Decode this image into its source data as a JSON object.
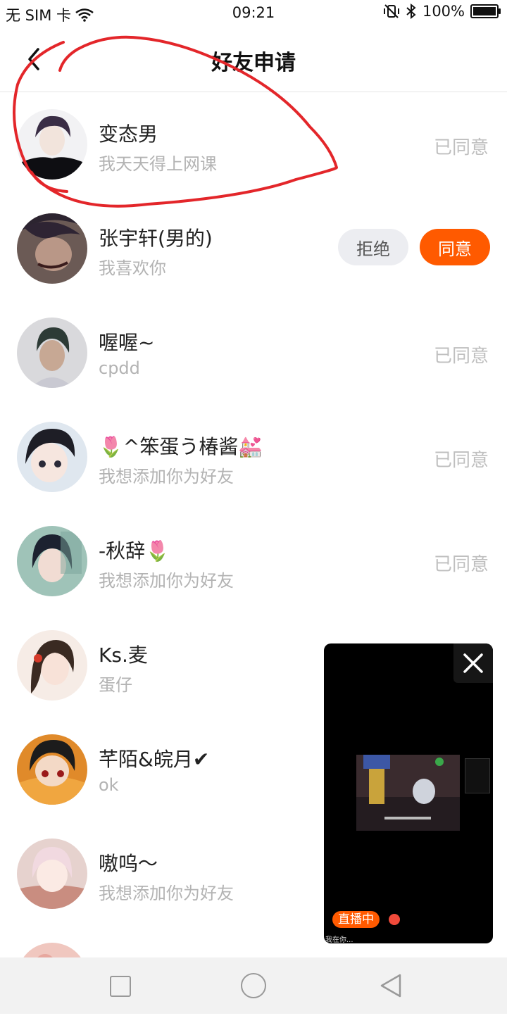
{
  "status": {
    "carrier": "无 SIM 卡",
    "time": "09:21",
    "battery": "100%"
  },
  "header": {
    "title": "好友申请"
  },
  "rows": [
    {
      "name": "变态男",
      "message": "我天天得上网课",
      "status": "已同意"
    },
    {
      "name": "张宇轩(男的)",
      "message": "我喜欢你",
      "reject_label": "拒绝",
      "accept_label": "同意"
    },
    {
      "name": "喔喔~",
      "message": "cpdd",
      "status": "已同意"
    },
    {
      "name": "🌷^笨蛋う椿酱💒",
      "message": "我想添加你为好友",
      "status": "已同意"
    },
    {
      "name": "-秋辞🌷",
      "message": "我想添加你为好友",
      "status": "已同意"
    },
    {
      "name": "Ks.麦",
      "message": "蛋仔"
    },
    {
      "name": "芊陌&皖月✔",
      "message": "ok"
    },
    {
      "name": "嗷呜～",
      "message": "我想添加你为好友"
    }
  ],
  "live_window": {
    "badge": "直播中",
    "caption": "我在你..."
  },
  "colors": {
    "accent": "#ff5a00",
    "annotation": "#e3262a"
  }
}
